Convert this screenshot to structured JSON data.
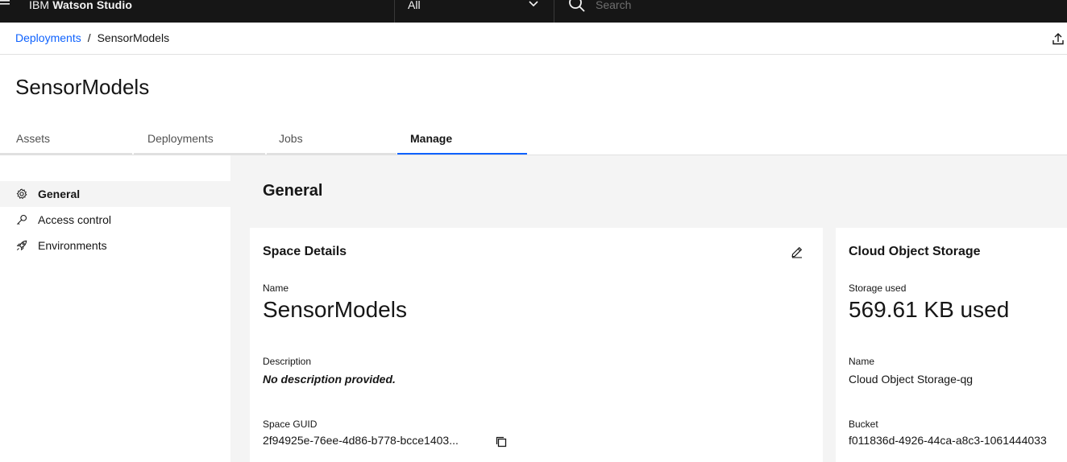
{
  "topbar": {
    "menu_icon": "hamburger-menu-icon",
    "brand_prefix": "IBM",
    "brand_name": "Watson Studio",
    "scope_select": {
      "value": "All"
    },
    "search": {
      "placeholder": "Search"
    }
  },
  "breadcrumb": {
    "link": "Deployments",
    "separator": "/",
    "current": "SensorModels"
  },
  "page": {
    "title": "SensorModels"
  },
  "tabs": [
    {
      "label": "Assets",
      "active": false
    },
    {
      "label": "Deployments",
      "active": false
    },
    {
      "label": "Jobs",
      "active": false
    },
    {
      "label": "Manage",
      "active": true
    }
  ],
  "sidebar": {
    "items": [
      {
        "label": "General",
        "icon": "gear-icon",
        "active": true
      },
      {
        "label": "Access control",
        "icon": "key-icon",
        "active": false
      },
      {
        "label": "Environments",
        "icon": "rocket-icon",
        "active": false
      }
    ]
  },
  "main": {
    "section_title": "General",
    "space_details": {
      "title": "Space Details",
      "name_label": "Name",
      "name_value": "SensorModels",
      "description_label": "Description",
      "description_value": "No description provided.",
      "guid_label": "Space GUID",
      "guid_value": "2f94925e-76ee-4d86-b778-bcce1403..."
    },
    "cloud_storage": {
      "title": "Cloud Object Storage",
      "storage_label": "Storage used",
      "storage_value": "569.61 KB used",
      "name_label": "Name",
      "name_value": "Cloud Object Storage-qg",
      "bucket_label": "Bucket",
      "bucket_value": "f011836d-4926-44ca-a8c3-1061444033"
    }
  },
  "colors": {
    "topbar_bg": "#161616",
    "link": "#0f62fe",
    "active_tab_underline": "#0f62fe",
    "main_bg": "#f4f4f4"
  }
}
